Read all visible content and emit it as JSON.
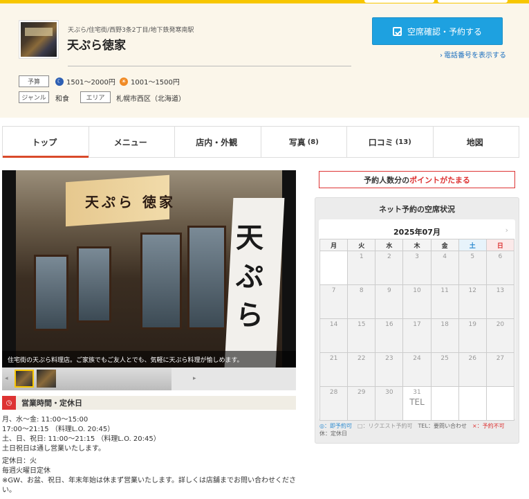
{
  "shop": {
    "breadcrumb": "天ぷら/住宅街/西野3条2丁目/地下鉄発寒南駅",
    "name": "天ぷら徳家"
  },
  "reserve": {
    "button_label": "空席確認・予約する",
    "tel_link": "電話番号を表示する"
  },
  "info": {
    "budget_label": "予算",
    "dinner_budget": "1501～2000円",
    "lunch_budget": "1001～1500円",
    "genre_label": "ジャンル",
    "genre_value": "和食",
    "area_label": "エリア",
    "area_value": "札幌市西区（北海道）"
  },
  "tabs": [
    {
      "label": "トップ",
      "count": ""
    },
    {
      "label": "メニュー",
      "count": ""
    },
    {
      "label": "店内・外観",
      "count": ""
    },
    {
      "label": "写真",
      "count": "(8)"
    },
    {
      "label": "口コミ",
      "count": "(13)"
    },
    {
      "label": "地図",
      "count": ""
    }
  ],
  "photo": {
    "caption": "住宅街の天ぷら料理店。ご家族でもご友人とでも、気軽に天ぷら料理が愉しめます。",
    "sign_text": "天ぷら 徳家",
    "banner_text": "天ぷら"
  },
  "hours": {
    "section_title": "営業時間・定休日",
    "lines": [
      "月、水～金: 11:00～15:00",
      "17:00～21:15 （料理L.O. 20:45）",
      "土、日、祝日: 11:00～21:15 （料理L.O. 20:45）",
      "土日祝日は通し営業いたします。"
    ],
    "closed_lines": [
      "定休日：火",
      "毎週火曜日定休",
      "※GW、お盆、祝日、年末年始は休まず営業いたします。詳しくは店舗までお問い合わせください。"
    ]
  },
  "points_banner": {
    "prefix": "予約人数分の",
    "highlight": "ポイントがたまる"
  },
  "calendar": {
    "panel_title": "ネット予約の空席状況",
    "month": "2025年07月",
    "weekdays": [
      "月",
      "火",
      "水",
      "木",
      "金",
      "土",
      "日"
    ],
    "weeks": [
      [
        "",
        "1",
        "2",
        "3",
        "4",
        "5",
        "6"
      ],
      [
        "7",
        "8",
        "9",
        "10",
        "11",
        "12",
        "13"
      ],
      [
        "14",
        "15",
        "16",
        "17",
        "18",
        "19",
        "20"
      ],
      [
        "21",
        "22",
        "23",
        "24",
        "25",
        "26",
        "27"
      ],
      [
        "28",
        "29",
        "30",
        "31",
        "",
        "",
        ""
      ]
    ],
    "marks": {
      "31": "TEL"
    },
    "legend": {
      "instant": "◎：即予約可",
      "request": "□：リクエスト予約可",
      "tel": "TEL：要問い合わせ",
      "none": "×：予約不可",
      "closed": "休：定休日"
    }
  },
  "colors": {
    "accent_yellow": "#f7c600",
    "reserve_blue": "#1ea1e0",
    "accent_red": "#d33"
  }
}
